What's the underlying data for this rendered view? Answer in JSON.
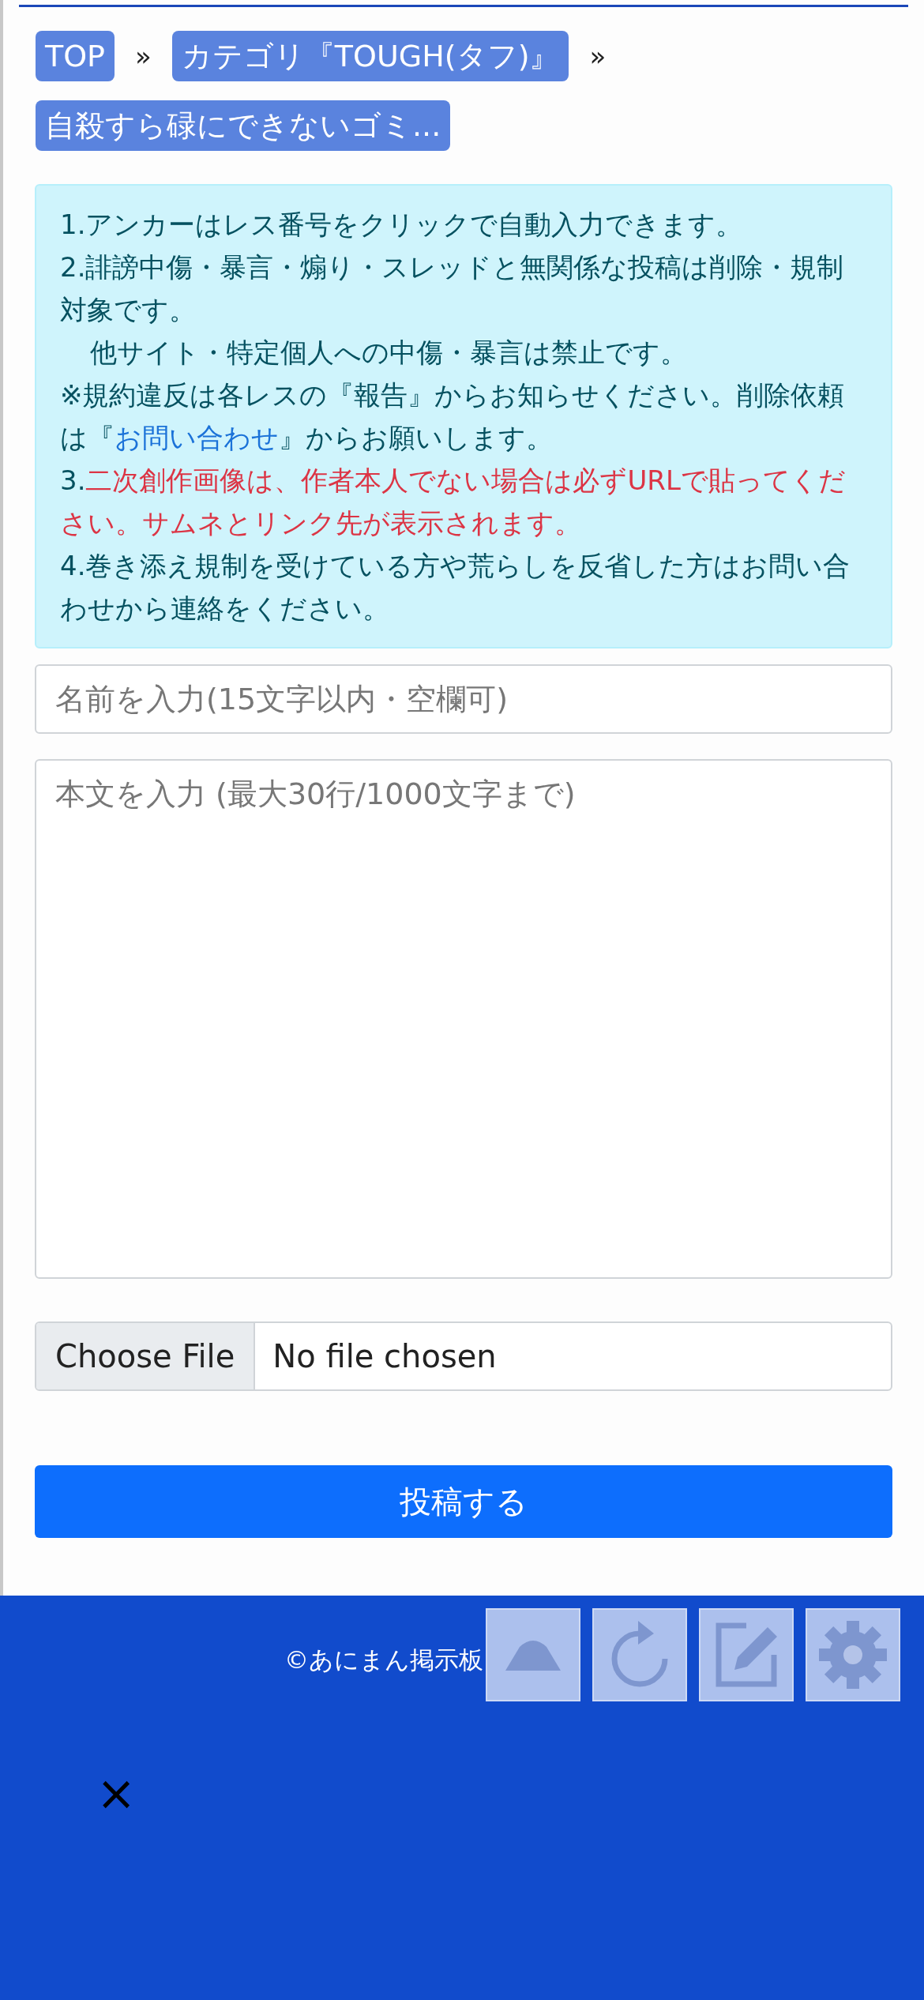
{
  "breadcrumb": [
    {
      "label": "TOP",
      "separator": "»"
    },
    {
      "label": "カテゴリ『TOUGH(タフ)』",
      "separator": "»"
    },
    {
      "label": "自殺すら碌にできないゴミ..."
    }
  ],
  "notice": [
    {
      "kind": "plain",
      "text": "1.アンカーはレス番号をクリックで自動入力できます。"
    },
    {
      "kind": "plain",
      "text": "2.誹謗中傷・暴言・煽り・スレッドと無関係な投稿は削除・規制対象です。"
    },
    {
      "kind": "indented",
      "text": "他サイト・特定個人への中傷・暴言は禁止です。"
    },
    {
      "kind": "link",
      "before": "※規約違反は各レスの『報告』からお知らせください。削除依頼は『",
      "link": "お問い合わせ",
      "after": "』からお願いします。"
    },
    {
      "kind": "warning",
      "prefix": "3.",
      "text": "二次創作画像は、作者本人でない場合は必ずURLで貼ってください。サムネとリンク先が表示されます。"
    },
    {
      "kind": "plain",
      "text": "4.巻き添え規制を受けている方や荒らしを反省した方はお問い合わせから連絡をください。"
    }
  ],
  "name_field": {
    "placeholder": "名前を入力(15文字以内・空欄可)"
  },
  "body_field": {
    "placeholder": "本文を入力 (最大30行/1000文字まで)"
  },
  "file_input": {
    "button": "Choose File",
    "status": "No file chosen"
  },
  "submit_button": "投稿する",
  "footer": {
    "copyright": "©あにまん掲示板",
    "close": "×"
  }
}
